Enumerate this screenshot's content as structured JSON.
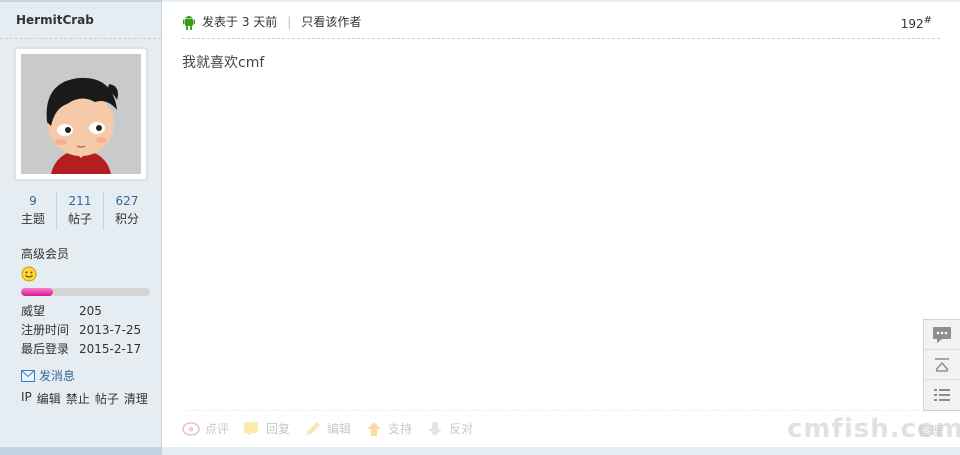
{
  "user": {
    "name": "HermitCrab",
    "stats": [
      {
        "value": "9",
        "label": "主题"
      },
      {
        "value": "211",
        "label": "帖子"
      },
      {
        "value": "627",
        "label": "积分"
      }
    ],
    "group": "高级会员",
    "progress": 0.25,
    "details": [
      {
        "label": "威望",
        "value": "205"
      },
      {
        "label": "注册时间",
        "value": "2013-7-25"
      },
      {
        "label": "最后登录",
        "value": "2015-2-17"
      }
    ],
    "send_message": "发消息",
    "admin_links": [
      "IP",
      "编辑",
      "禁止",
      "帖子",
      "清理"
    ]
  },
  "post": {
    "posted": "发表于 3 天前",
    "only_author": "只看该作者",
    "floor": "192",
    "floor_sup": "#",
    "content": "我就喜欢cmf",
    "actions": [
      "点评",
      "回复",
      "编辑",
      "支持",
      "反对"
    ],
    "manage": "管理",
    "watermark": "cmfish.com"
  },
  "colors": {
    "sidebar_bg": "#e5edf2",
    "link": "#336699",
    "progress_fill": "#e0339f"
  },
  "floating_toolbar": [
    "comment-icon",
    "back-to-top-icon",
    "list-icon"
  ]
}
